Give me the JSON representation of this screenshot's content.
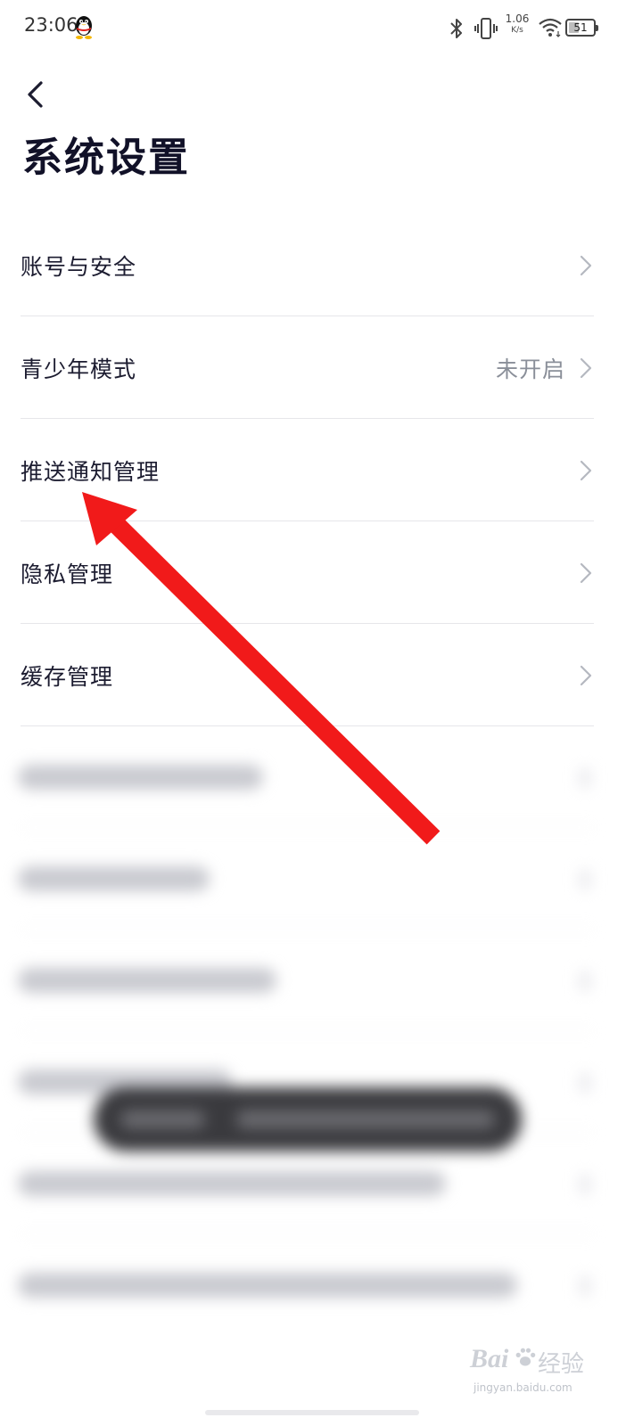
{
  "status_bar": {
    "time": "23:06",
    "qq_icon": "qq-penguin-icon",
    "bluetooth_icon": "bluetooth-icon",
    "vibrate_icon": "vibrate-icon",
    "network_speed_value": "1.06",
    "network_speed_unit": "K/s",
    "wifi_icon": "wifi-icon",
    "battery_level": "51",
    "battery_fraction": 0.51
  },
  "header": {
    "back_icon": "chevron-left-icon",
    "title": "系统设置"
  },
  "settings": {
    "items": [
      {
        "label": "账号与安全",
        "value": "",
        "icon": "chevron-right-icon"
      },
      {
        "label": "青少年模式",
        "value": "未开启",
        "icon": "chevron-right-icon"
      },
      {
        "label": "推送通知管理",
        "value": "",
        "icon": "chevron-right-icon"
      },
      {
        "label": "隐私管理",
        "value": "",
        "icon": "chevron-right-icon"
      },
      {
        "label": "缓存管理",
        "value": "",
        "icon": "chevron-right-icon"
      }
    ]
  },
  "annotation": {
    "arrow_color": "#f11a1a",
    "arrow_target": "推送通知管理"
  },
  "watermark": {
    "brand": "Bai",
    "cn": "经验",
    "url": "jingyan.baidu.com"
  },
  "colors": {
    "title": "#111128",
    "label": "#1c1c30",
    "value": "#8a8f99",
    "divider": "#e6e6ea",
    "chevron": "#b5b8c0"
  }
}
